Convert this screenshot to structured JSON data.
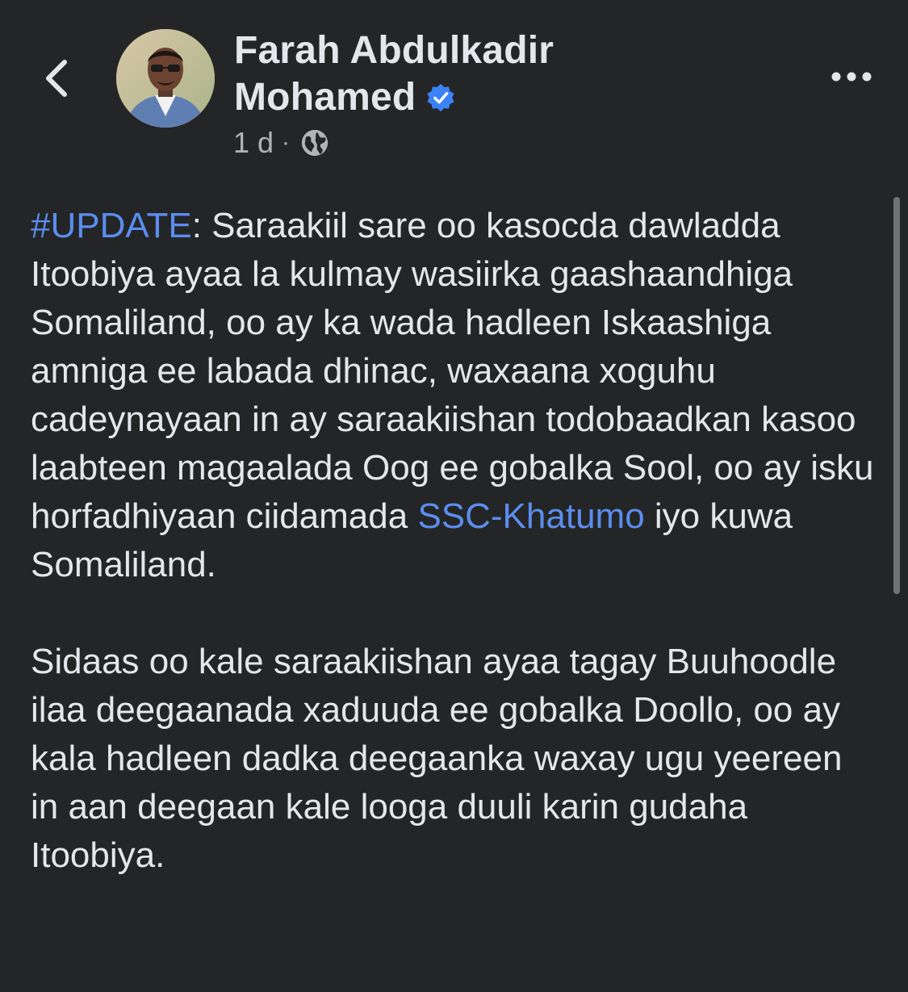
{
  "header": {
    "author_line1": "Farah Abdulkadir",
    "author_line2": "Mohamed",
    "timestamp": "1 d",
    "separator": "·",
    "icons": {
      "back": "chevron-left-icon",
      "verified": "verified-badge-icon",
      "privacy": "globe-icon",
      "more": "more-options-icon"
    }
  },
  "post": {
    "hashtag": "#UPDATE",
    "p1_a": ": Saraakiil sare oo kasocda dawladda Itoobiya ayaa la kulmay wasiirka gaashaandhiga Somaliland, oo ay ka wada hadleen Iskaashiga amniga ee labada dhinac, waxaana xoguhu cadeynayaan in ay saraakiishan todobaadkan kasoo laabteen magaalada Oog ee gobalka Sool, oo ay isku horfadhiyaan ciidamada ",
    "mention": "SSC-Khatumo",
    "p1_b": " iyo kuwa Somaliland.",
    "p2": "Sidaas oo kale saraakiishan ayaa tagay Buuhoodle ilaa deegaanada xaduuda ee gobalka Doollo, oo ay kala hadleen dadka deegaanka waxay ugu yeereen in aan deegaan kale looga duuli karin gudaha Itoobiya."
  },
  "colors": {
    "background": "#242526",
    "text": "#e4e6eb",
    "secondary_text": "#b0b3b8",
    "link": "#5a8dee",
    "verified": "#3b82f6"
  }
}
